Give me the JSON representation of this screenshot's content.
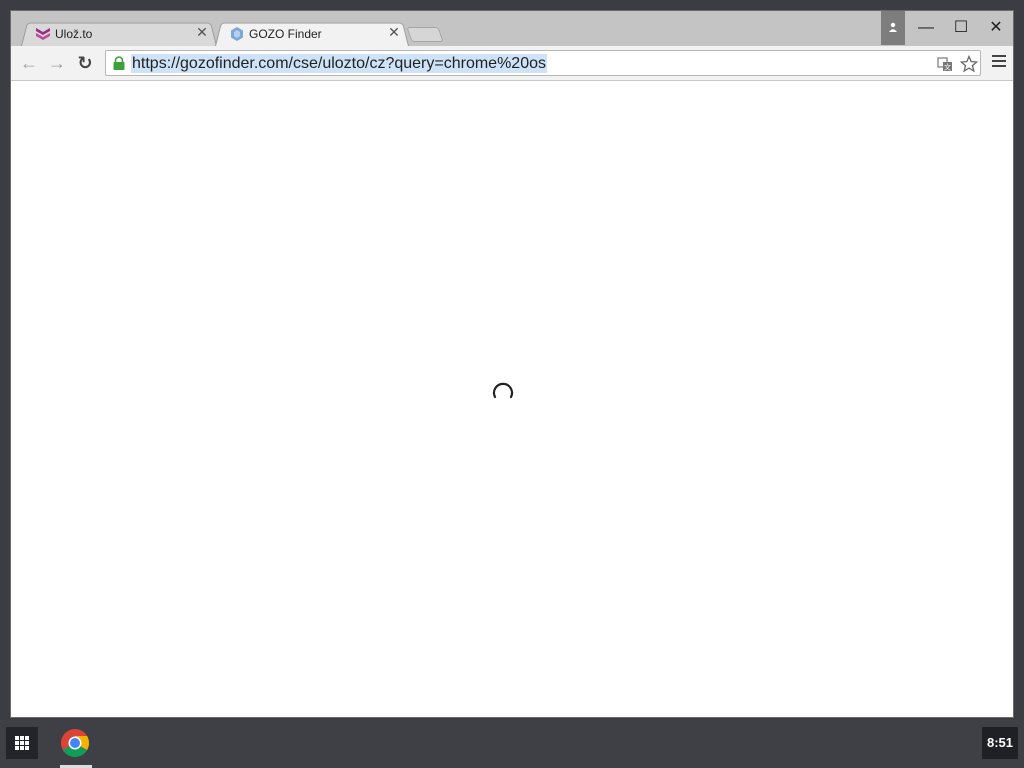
{
  "tabs": [
    {
      "title": "Ulož.to",
      "favicon": "uloz-to-logo-icon",
      "active": false
    },
    {
      "title": "GOZO Finder",
      "favicon": "gozo-finder-icon",
      "active": true
    }
  ],
  "tab_close_glyph": "✕",
  "window_controls": {
    "minimize": "—",
    "maximize": "☐",
    "close": "✕"
  },
  "toolbar": {
    "url": "https://gozofinder.com/cse/ulozto/cz?query=chrome%20os",
    "back": "←",
    "forward": "→",
    "reload": "↻"
  },
  "shelf": {
    "clock": "8:51"
  },
  "colors": {
    "uloz_brand": "#9b2c7e",
    "gozo_brand": "#7ba7d9",
    "url_selection": "#cfe3f8",
    "lock_green": "#3ea03c"
  }
}
